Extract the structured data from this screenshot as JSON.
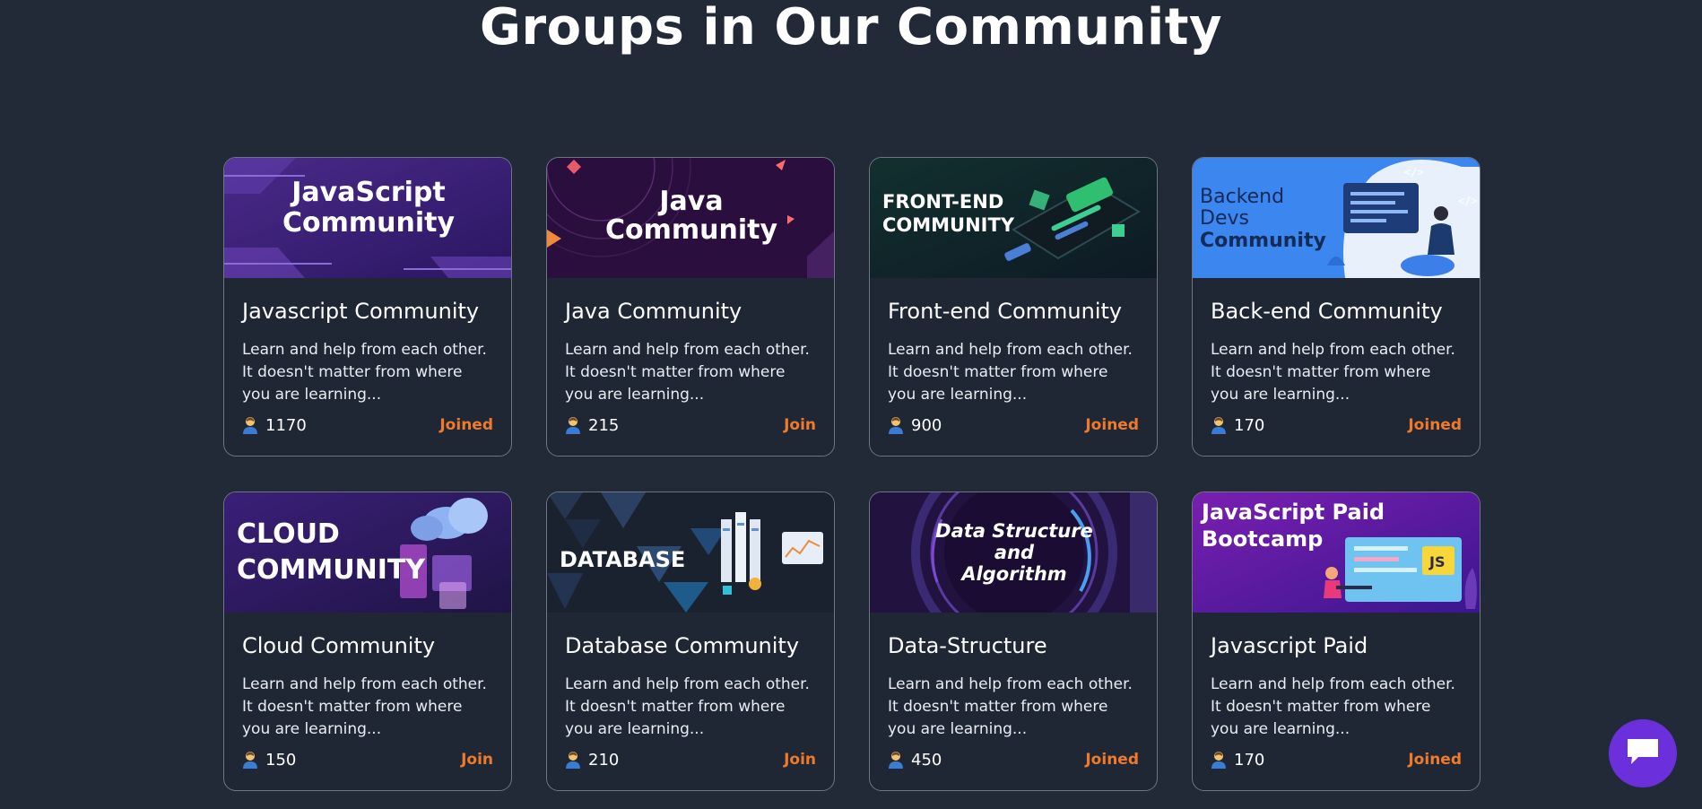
{
  "page": {
    "title": "Groups in Our Community"
  },
  "groups": [
    {
      "banner_lines": [
        "JavaScript",
        "Community"
      ],
      "title": "Javascript Community",
      "description": "Learn and help from each other. It doesn't matter from where you are learning...",
      "members": "1170",
      "action": "Joined",
      "banner_icon": "javascript-banner"
    },
    {
      "banner_lines": [
        "Java",
        "Community"
      ],
      "title": "Java Community",
      "description": "Learn and help from each other. It doesn't matter from where you are learning...",
      "members": "215",
      "action": "Join",
      "banner_icon": "java-banner"
    },
    {
      "banner_lines": [
        "FRONT-END",
        "COMMUNITY"
      ],
      "title": "Front-end Community",
      "description": "Learn and help from each other. It doesn't matter from where you are learning...",
      "members": "900",
      "action": "Joined",
      "banner_icon": "frontend-banner"
    },
    {
      "banner_lines": [
        "Backend",
        "Devs",
        "Community"
      ],
      "title": "Back-end Community",
      "description": "Learn and help from each other. It doesn't matter from where you are learning...",
      "members": "170",
      "action": "Joined",
      "banner_icon": "backend-banner"
    },
    {
      "banner_lines": [
        "CLOUD",
        "COMMUNITY"
      ],
      "title": "Cloud Community",
      "description": "Learn and help from each other. It doesn't matter from where you are learning...",
      "members": "150",
      "action": "Join",
      "banner_icon": "cloud-banner"
    },
    {
      "banner_lines": [
        "DATABASE"
      ],
      "title": "Database Community",
      "description": "Learn and help from each other. It doesn't matter from where you are learning...",
      "members": "210",
      "action": "Join",
      "banner_icon": "database-banner"
    },
    {
      "banner_lines": [
        "Data Structure",
        "and",
        "Algorithm"
      ],
      "title": "Data-Structure",
      "description": "Learn and help from each other. It doesn't matter from where you are learning...",
      "members": "450",
      "action": "Joined",
      "banner_icon": "dsa-banner"
    },
    {
      "banner_lines": [
        "JavaScript Paid",
        "Bootcamp",
        "JS"
      ],
      "title": "Javascript Paid",
      "description": "Learn and help from each other. It doesn't matter from where you are learning...",
      "members": "170",
      "action": "Joined",
      "banner_icon": "js-bootcamp-banner"
    }
  ],
  "colors": {
    "background": "#222a38",
    "card": "#1f2735",
    "accent": "#f07a2b",
    "chat": "#6b2fdc"
  },
  "chat": {
    "icon": "chat-bubble-icon"
  }
}
